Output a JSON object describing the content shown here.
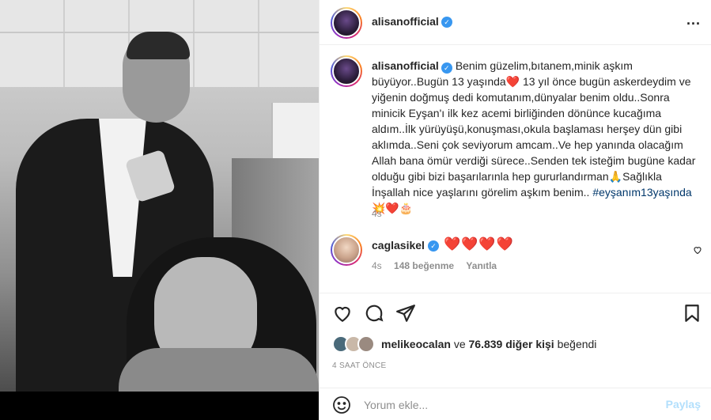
{
  "header": {
    "username": "alisanofficial",
    "verified_icon": "verified-badge-icon",
    "more_icon": "more-options-icon",
    "more_label": "..."
  },
  "caption": {
    "username": "alisanofficial",
    "text_part1": "Benim güzelim,bıtanem,minik aşkım büyüyor..Bugün 13 yaşında",
    "heart1": "❤️",
    "text_part2": " 13 yıl önce bugün askerdeydim ve yiğenin doğmuş dedi komutanım,dünyalar benim oldu..Sonra minicik Eyşan'ı ilk kez acemi birliğinden dönünce kucağıma aldım..İlk yürüyüşü,konuşması,okula başlaması herşey dün gibi aklımda..Seni çok seviyorum amcam..Ve hep yanında olacağım Allah bana ömür verdiği sürece..Senden tek isteğim bugüne kadar olduğu gibi bizi başarılarınla hep gururlandırman",
    "pray": "🙏",
    "text_part3": "Sağlıkla İnşallah nice yaşlarını görelim aşkım benim.. ",
    "hashtag": "#eyşanım13yaşında",
    "end_emojis": "💥❤️🎂",
    "time": "4s"
  },
  "comment": {
    "username": "caglasikel",
    "hearts": "❤️❤️❤️❤️",
    "time": "4s",
    "likes": "148 beğenme",
    "reply": "Yanıtla",
    "like_icon": "heart-outline-icon"
  },
  "actions": {
    "like_icon": "heart-outline-icon",
    "comment_icon": "comment-icon",
    "share_icon": "paper-plane-icon",
    "save_icon": "bookmark-icon"
  },
  "likes": {
    "first_user": "melikeocalan",
    "connector": " ve ",
    "count": "76.839 diğer kişi",
    "suffix": " beğendi"
  },
  "timestamp": "4 SAAT ÖNCE",
  "add_comment": {
    "placeholder": "Yorum ekle...",
    "post_label": "Paylaş",
    "emoji_icon": "smiley-icon"
  },
  "colors": {
    "verified": "#3897f0",
    "heart": "#ed4956",
    "hashtag": "#00376b",
    "post_disabled": "#b2dffc"
  }
}
